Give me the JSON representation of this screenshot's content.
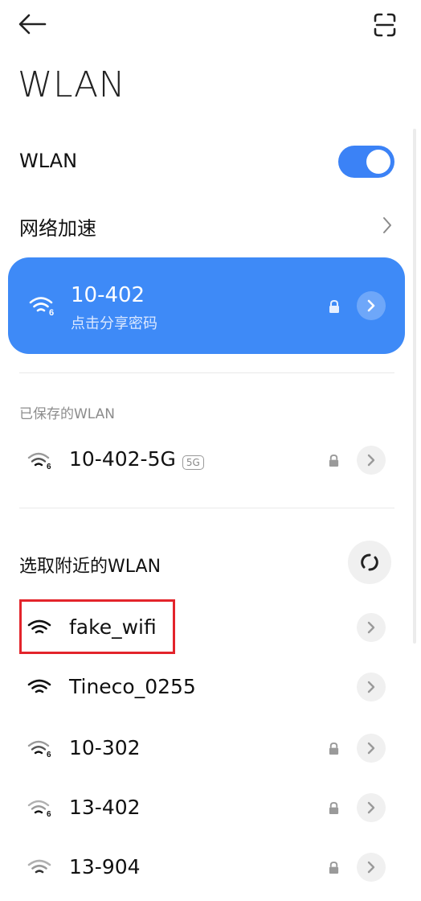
{
  "header": {
    "back_icon": "arrow-left-icon",
    "scan_icon": "scan-frame-icon",
    "title": "WLAN"
  },
  "wlan_toggle": {
    "label": "WLAN",
    "on": true,
    "accent": "#3b82f6"
  },
  "network_acceleration": {
    "label": "网络加速"
  },
  "connected": {
    "name": "10-402",
    "subtitle": "点击分享密码",
    "card_color": "#3e8af7"
  },
  "saved": {
    "section_label": "已保存的WLAN",
    "items": [
      {
        "name": "10-402-5G",
        "badge": "5G",
        "locked": true
      }
    ]
  },
  "nearby": {
    "section_label": "选取附近的WLAN",
    "refresh_icon": "refresh-icon",
    "items": [
      {
        "name": "fake_wifi",
        "locked": false,
        "highlighted": true
      },
      {
        "name": "Tineco_0255",
        "locked": false
      },
      {
        "name": "10-302",
        "locked": true
      },
      {
        "name": "13-402",
        "locked": true
      },
      {
        "name": "13-904",
        "locked": true
      }
    ]
  },
  "colors": {
    "highlight": "#e3242b"
  }
}
